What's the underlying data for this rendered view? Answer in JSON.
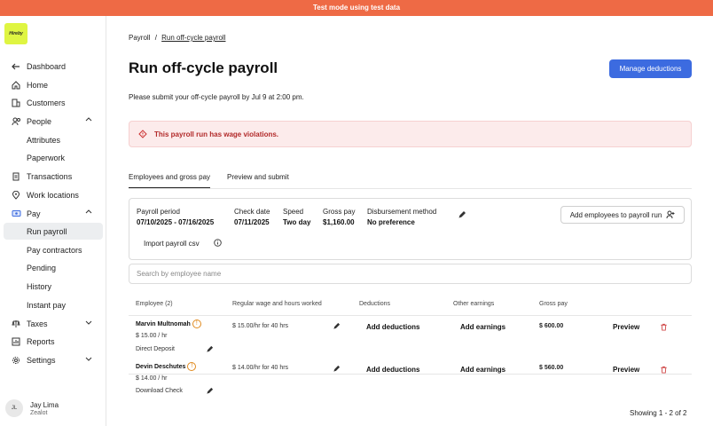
{
  "banner": "Test mode using test data",
  "logo_text": "Hireby",
  "sidebar": {
    "items": [
      {
        "label": "Dashboard",
        "icon": "arrow-left-icon"
      },
      {
        "label": "Home",
        "icon": "home-icon"
      },
      {
        "label": "Customers",
        "icon": "building-icon"
      },
      {
        "label": "People",
        "icon": "people-icon"
      },
      {
        "label": "Attributes"
      },
      {
        "label": "Paperwork"
      },
      {
        "label": "Transactions",
        "icon": "document-icon"
      },
      {
        "label": "Work locations",
        "icon": "location-pin-icon"
      },
      {
        "label": "Pay",
        "icon": "money-icon"
      },
      {
        "label": "Run payroll"
      },
      {
        "label": "Pay contractors"
      },
      {
        "label": "Pending"
      },
      {
        "label": "History"
      },
      {
        "label": "Instant pay"
      },
      {
        "label": "Taxes",
        "icon": "scale-icon"
      },
      {
        "label": "Reports",
        "icon": "chart-icon"
      },
      {
        "label": "Settings",
        "icon": "gear-icon"
      }
    ]
  },
  "user": {
    "initials": "JL",
    "name": "Jay Lima",
    "role": "Zealot"
  },
  "breadcrumb": {
    "root": "Payroll",
    "sep": "/",
    "current": "Run off-cycle payroll"
  },
  "page": {
    "title": "Run off-cycle payroll",
    "manage_btn": "Manage deductions",
    "subtitle": "Please submit your off-cycle payroll by Jul 9 at 2:00 pm.",
    "alert": "This payroll run has wage violations."
  },
  "tabs": [
    "Employees and gross pay",
    "Preview and submit"
  ],
  "summary": {
    "period_label": "Payroll period",
    "period_value": "07/10/2025 - 07/16/2025",
    "check_label": "Check date",
    "check_value": "07/11/2025",
    "speed_label": "Speed",
    "speed_value": "Two day",
    "gross_label": "Gross pay",
    "gross_value": "$1,160.00",
    "disb_label": "Disbursement method",
    "disb_value": "No preference",
    "add_employees_btn": "Add employees to payroll run",
    "import_label": "Import payroll csv"
  },
  "search_placeholder": "Search by employee name",
  "table": {
    "headers": [
      "Employee (2)",
      "Regular wage and hours worked",
      "Deductions",
      "Other earnings",
      "Gross pay"
    ],
    "rows": [
      {
        "name": "Marvin Multnomah",
        "rate": "$ 15.00 / hr",
        "method": "Direct Deposit",
        "wage": "$ 15.00/hr for 40 hrs",
        "deductions": "Add deductions",
        "earnings": "Add earnings",
        "gross": "$ 600.00",
        "preview": "Preview"
      },
      {
        "name": "Devin Deschutes",
        "rate": "$ 14.00 / hr",
        "method": "Download Check",
        "wage": "$ 14.00/hr for 40 hrs",
        "deductions": "Add deductions",
        "earnings": "Add earnings",
        "gross": "$ 560.00",
        "preview": "Preview"
      }
    ]
  },
  "footer": "Showing 1 - 2 of 2"
}
